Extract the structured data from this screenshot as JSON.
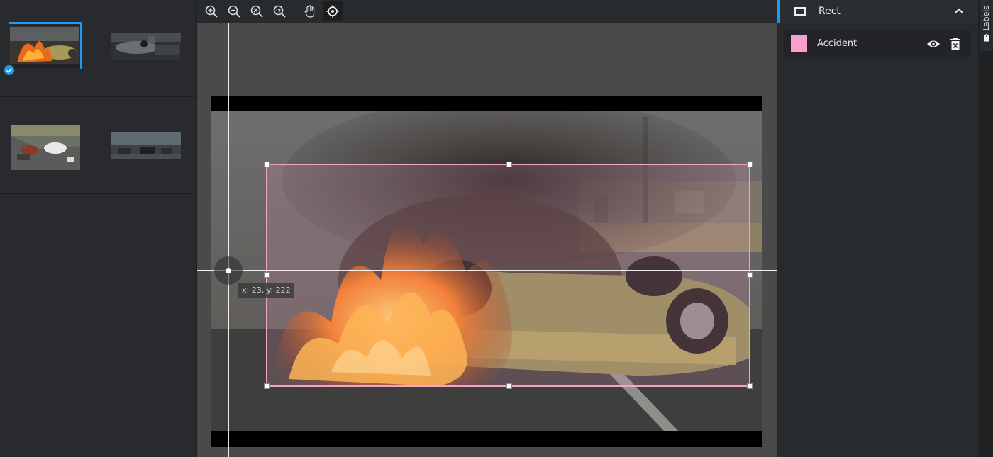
{
  "images": [
    {
      "name": "burning-overturned-car",
      "selected": true,
      "checked": true
    },
    {
      "name": "overturned-car-dark"
    },
    {
      "name": "crash-scene-white-car"
    },
    {
      "name": "cars-on-road-dusk"
    }
  ],
  "toolbar": {
    "tools": [
      {
        "icon": "zoom-in-icon"
      },
      {
        "icon": "zoom-out-icon"
      },
      {
        "icon": "zoom-fit-icon"
      },
      {
        "icon": "zoom-actual-size-icon"
      },
      {
        "icon": "hand-pan-icon"
      },
      {
        "icon": "crosshair-icon",
        "active": true
      }
    ]
  },
  "editor": {
    "cursor_readout": "x: 23, y: 222"
  },
  "labels_panel": {
    "section_title": "Rect",
    "labels": [
      {
        "name": "Accident",
        "color": "#f79fcf"
      }
    ]
  },
  "side_tab": {
    "label": "Labels"
  },
  "colors": {
    "accent": "#1e9af0",
    "bbox": "#f4a3c8"
  }
}
